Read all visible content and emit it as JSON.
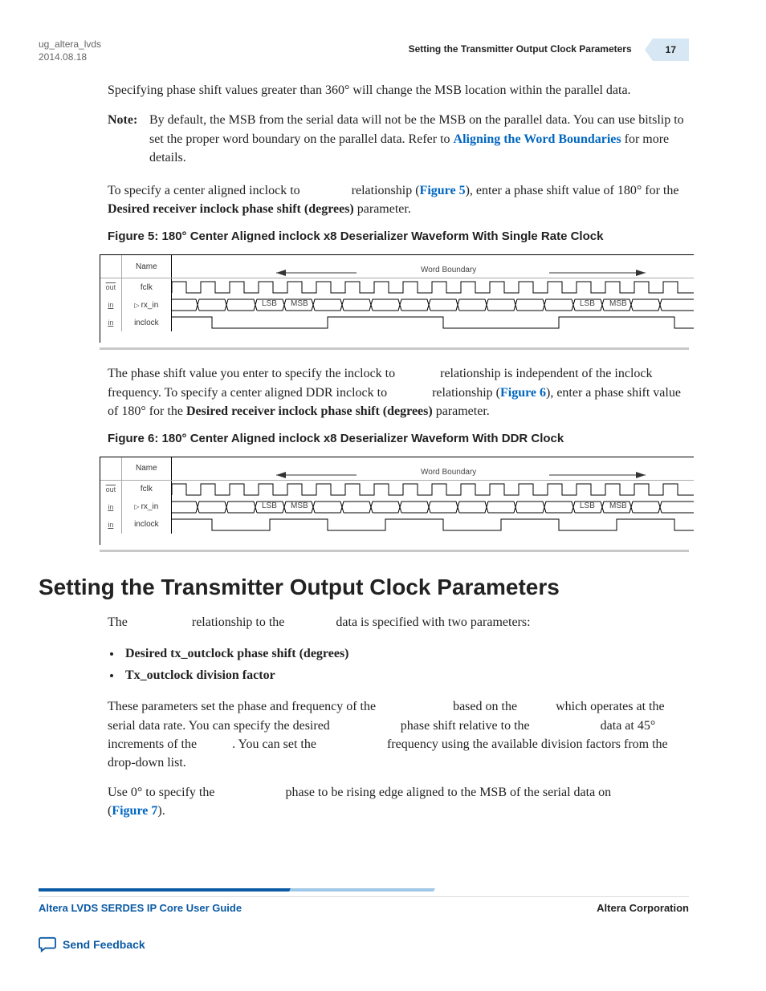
{
  "header": {
    "doc_id": "ug_altera_lvds",
    "date": "2014.08.18",
    "title": "Setting the Transmitter Output Clock Parameters",
    "page_num": "17"
  },
  "para1": "Specifying phase shift values greater than 360° will change the MSB location within the parallel data.",
  "note": {
    "label": "Note:",
    "text_a": "By default, the MSB from the serial data will not be the MSB on the parallel data. You can use bitslip to set the proper word boundary on the parallel data. Refer to ",
    "link": "Aligning the Word Boundaries",
    "text_b": " for more details."
  },
  "para2_a": "To specify a center aligned inclock to ",
  "para2_gap1": "",
  "para2_b": " relationship (",
  "para2_link": "Figure 5",
  "para2_c": "), enter a phase shift value of 180° for the ",
  "para2_bold": "Desired receiver inclock phase shift (degrees)",
  "para2_d": " parameter.",
  "fig5_title": "Figure 5: 180° Center Aligned inclock x8 Deserializer Waveform With Single Rate Clock",
  "wave": {
    "col_name": "Name",
    "row_fclk": "fclk",
    "row_rxin": "rx_in",
    "row_inclock": "inclock",
    "word_boundary": "Word Boundary",
    "lsb": "LSB",
    "msb": "MSB",
    "icon_out": "out",
    "icon_in": "in",
    "tri": "▷"
  },
  "para3_a": "The phase shift value you enter to specify the inclock to ",
  "para3_b": " relationship is independent of the inclock frequency. To specify a center aligned DDR inclock to ",
  "para3_c": " relationship (",
  "para3_link": "Figure 6",
  "para3_d": "), enter a phase shift value of 180° for the ",
  "para3_bold": "Desired receiver inclock phase shift (degrees)",
  "para3_e": " parameter.",
  "fig6_title": "Figure 6: 180° Center Aligned inclock x8 Deserializer Waveform With DDR Clock",
  "heading": "Setting the Transmitter Output Clock Parameters",
  "para4_a": "The ",
  "para4_b": " relationship to the ",
  "para4_c": " data is specified with two parameters:",
  "bullets": {
    "b1": "Desired tx_outclock phase shift (degrees)",
    "b2": "Tx_outclock division factor"
  },
  "para5_a": "These parameters set the phase and frequency of the ",
  "para5_b": " based on the ",
  "para5_c": " which operates at the serial data rate. You can specify the desired ",
  "para5_d": " phase shift relative to the ",
  "para5_e": " data at 45° increments of the ",
  "para5_f": ". You can set the ",
  "para5_g": " frequency using the available division factors from the drop-down list.",
  "para6_a": "Use 0° to specify the ",
  "para6_b": " phase to be rising edge aligned to the MSB of the serial data on ",
  "para6_c": " (",
  "para6_link": "Figure 7",
  "para6_d": ").",
  "footer": {
    "guide": "Altera LVDS SERDES IP Core User Guide",
    "corp": "Altera Corporation",
    "feedback": "Send Feedback"
  }
}
